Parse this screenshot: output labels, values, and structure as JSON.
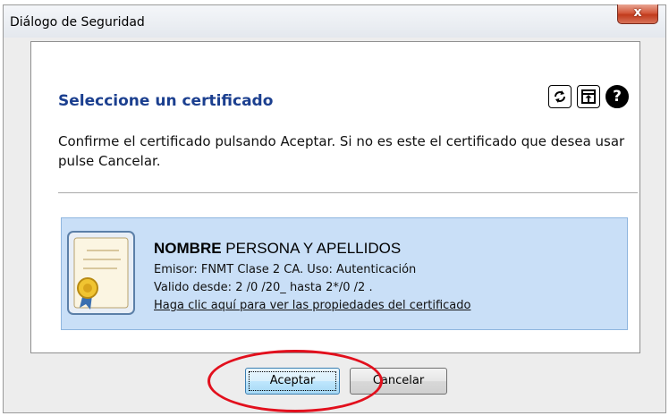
{
  "window": {
    "title": "Diálogo de Seguridad",
    "close_label": "x"
  },
  "panel": {
    "heading": "Seleccione un certificado",
    "toolbar_icons": [
      "refresh-icon",
      "import-icon",
      "help-icon"
    ],
    "help_glyph": "?",
    "message": "Confirme el certificado pulsando Aceptar. Si no es este el certificado que desea usar pulse Cancelar."
  },
  "certificate": {
    "name_bold": "NOMBRE",
    "name_rest": " PERSONA Y APELLIDOS",
    "issuer_line": "Emisor: FNMT Clase 2 CA. Uso: Autenticación",
    "validity_line": "Valido desde: 2 /0 /20_ hasta 2*/0 /2 .",
    "properties_link": "Haga clic aquí para ver las propiedades del certificado"
  },
  "buttons": {
    "accept": "Aceptar",
    "cancel": "Cancelar"
  },
  "colors": {
    "heading": "#1b3f8f",
    "card_bg": "#c9dff7",
    "close_red": "#c13b1c",
    "annotation_red": "#e2101d"
  }
}
